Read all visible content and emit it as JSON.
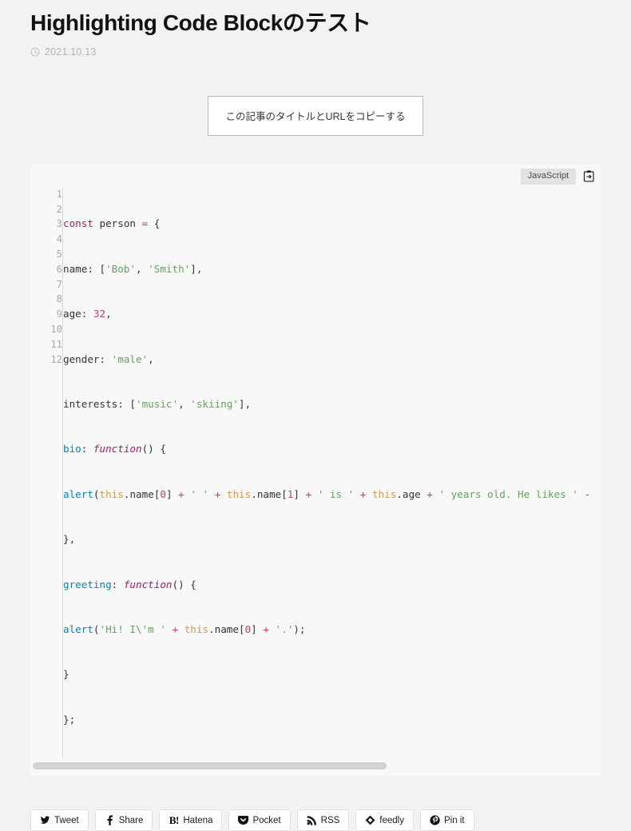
{
  "article": {
    "title": "Highlighting Code Blockのテスト",
    "date": "2021.10.13",
    "clock_icon": "clock-icon"
  },
  "copy_title_button": {
    "label": "この記事のタイトルとURLをコピーする"
  },
  "code_block": {
    "language_badge": "JavaScript",
    "copy_icon": "clipboard-copy-icon",
    "line_numbers": [
      "1",
      "2",
      "3",
      "4",
      "5",
      "6",
      "7",
      "8",
      "9",
      "10",
      "11",
      "12"
    ],
    "lines": [
      "const person = {",
      "name: ['Bob', 'Smith'],",
      "age: 32,",
      "gender: 'male',",
      "interests: ['music', 'skiing'],",
      "bio: function() {",
      "alert(this.name[0] + ' ' + this.name[1] + ' is ' + this.age + ' years old. He likes ' -",
      "},",
      "greeting: function() {",
      "alert('Hi! I\\'m ' + this.name[0] + '.');",
      "}",
      "};"
    ],
    "scrollbar": {
      "thumb_width_percent": 62
    },
    "colors": {
      "background": "#f8f8f8",
      "keyword": "#a71d5d",
      "string": "#63a35c",
      "number": "#b5407b",
      "operator": "#c7365f",
      "attribute": "#0086b3",
      "this": "#d19a4c",
      "plain": "#333333",
      "gutter": "#a8a8a8"
    }
  },
  "share_buttons": [
    {
      "label": "Tweet",
      "icon": "twitter-icon"
    },
    {
      "label": "Share",
      "icon": "facebook-icon"
    },
    {
      "label": "Hatena",
      "icon": "hatena-icon"
    },
    {
      "label": "Pocket",
      "icon": "pocket-icon"
    },
    {
      "label": "RSS",
      "icon": "rss-icon"
    },
    {
      "label": "feedly",
      "icon": "feedly-icon"
    },
    {
      "label": "Pin it",
      "icon": "pinterest-icon"
    }
  ],
  "page": {
    "background": "#f2f2f2"
  }
}
